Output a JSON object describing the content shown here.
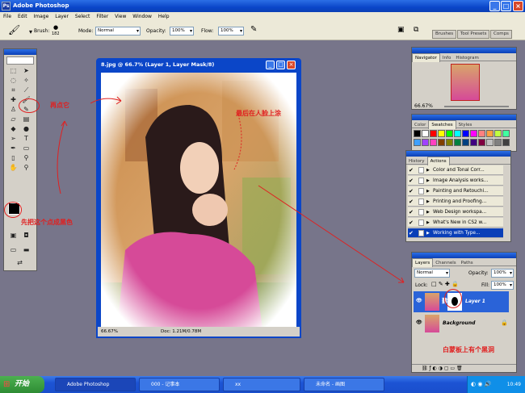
{
  "window": {
    "title": "Adobe Photoshop",
    "icon": "Ps"
  },
  "menu": [
    "File",
    "Edit",
    "Image",
    "Layer",
    "Select",
    "Filter",
    "View",
    "Window",
    "Help"
  ],
  "options": {
    "brush_label": "Brush:",
    "brush_size": "182",
    "mode_label": "Mode:",
    "mode": "Normal",
    "opacity_label": "Opacity:",
    "opacity": "100%",
    "flow_label": "Flow:",
    "flow": "100%"
  },
  "well_tabs": [
    "Brushes",
    "Tool Presets",
    "Comps"
  ],
  "document": {
    "title": "8.jpg @ 66.7% (Layer 1, Layer Mask/8)",
    "zoom": "66.67%",
    "doc_size": "Doc: 1.21M/0.78M"
  },
  "navigator": {
    "tabs": [
      "Navigator",
      "Info",
      "Histogram"
    ],
    "zoom": "66.67%"
  },
  "swatches": {
    "tabs": [
      "Color",
      "Swatches",
      "Styles"
    ],
    "colors": [
      "#000000",
      "#ffffff",
      "#ff0000",
      "#ffff00",
      "#00ff00",
      "#00ffff",
      "#0000ff",
      "#ff00ff",
      "#ff8080",
      "#ffa040",
      "#c0ff40",
      "#40ffa0",
      "#40a0ff",
      "#a040ff",
      "#ff40c0",
      "#804000",
      "#808000",
      "#008040",
      "#004080",
      "#400080",
      "#800040",
      "#c0c0c0",
      "#808080",
      "#404040"
    ]
  },
  "actions": {
    "tabs": [
      "History",
      "Actions"
    ],
    "items": [
      "Color and Tonal Corr...",
      "Image Analysis works...",
      "Painting and Retouchi...",
      "Printing and Proofing...",
      "Web Design workspa...",
      "What's New in CS2 w...",
      "Working with Type..."
    ]
  },
  "layers": {
    "tabs": [
      "Layers",
      "Channels",
      "Paths"
    ],
    "blend": "Normal",
    "opacity_label": "Opacity:",
    "opacity": "100%",
    "lock_label": "Lock:",
    "fill_label": "Fill:",
    "fill": "100%",
    "items": [
      {
        "name": "Layer 1"
      },
      {
        "name": "Background"
      }
    ]
  },
  "annotations": {
    "a1": "再点它",
    "a2": "最后在人脸上涂",
    "a3": "先把这个点成黑色",
    "a4": "白蒙板上有个黑洞"
  },
  "taskbar": {
    "start": "开始",
    "tasks": [
      "Adobe Photoshop",
      "000 - 记事本",
      "xx",
      "未命名 - 画图"
    ],
    "time": "10:49"
  }
}
